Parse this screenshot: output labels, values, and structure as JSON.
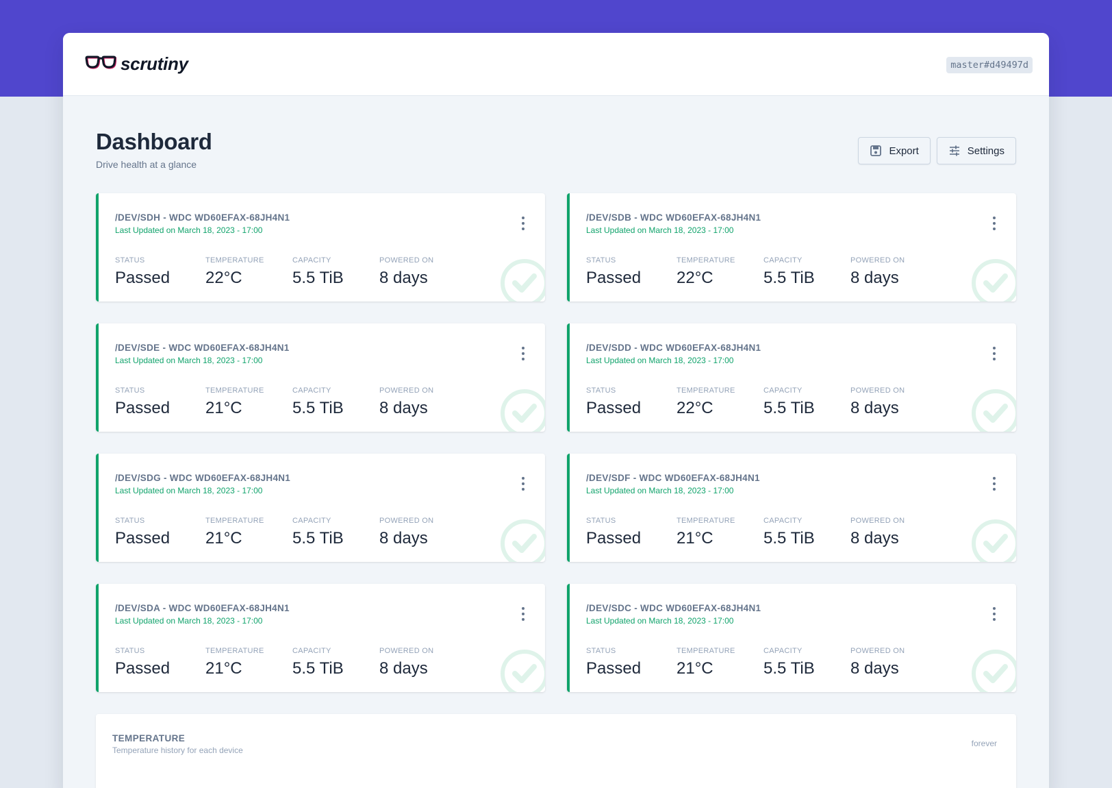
{
  "app": {
    "name": "scrutiny",
    "version": "master#d49497d"
  },
  "page": {
    "title": "Dashboard",
    "subtitle": "Drive health at a glance"
  },
  "actions": {
    "export_label": "Export",
    "settings_label": "Settings"
  },
  "colors": {
    "brand": "#5046cd",
    "passed": "#10a36b"
  },
  "stat_labels": {
    "status": "STATUS",
    "temperature": "TEMPERATURE",
    "capacity": "CAPACITY",
    "powered_on": "POWERED ON"
  },
  "devices": [
    {
      "title": "/DEV/SDH - WDC WD60EFAX-68JH4N1",
      "updated": "Last Updated on March 18, 2023 - 17:00",
      "status": "Passed",
      "temperature": "22°C",
      "capacity": "5.5 TiB",
      "powered_on": "8 days"
    },
    {
      "title": "/DEV/SDB - WDC WD60EFAX-68JH4N1",
      "updated": "Last Updated on March 18, 2023 - 17:00",
      "status": "Passed",
      "temperature": "22°C",
      "capacity": "5.5 TiB",
      "powered_on": "8 days"
    },
    {
      "title": "/DEV/SDE - WDC WD60EFAX-68JH4N1",
      "updated": "Last Updated on March 18, 2023 - 17:00",
      "status": "Passed",
      "temperature": "21°C",
      "capacity": "5.5 TiB",
      "powered_on": "8 days"
    },
    {
      "title": "/DEV/SDD - WDC WD60EFAX-68JH4N1",
      "updated": "Last Updated on March 18, 2023 - 17:00",
      "status": "Passed",
      "temperature": "22°C",
      "capacity": "5.5 TiB",
      "powered_on": "8 days"
    },
    {
      "title": "/DEV/SDG - WDC WD60EFAX-68JH4N1",
      "updated": "Last Updated on March 18, 2023 - 17:00",
      "status": "Passed",
      "temperature": "21°C",
      "capacity": "5.5 TiB",
      "powered_on": "8 days"
    },
    {
      "title": "/DEV/SDF - WDC WD60EFAX-68JH4N1",
      "updated": "Last Updated on March 18, 2023 - 17:00",
      "status": "Passed",
      "temperature": "21°C",
      "capacity": "5.5 TiB",
      "powered_on": "8 days"
    },
    {
      "title": "/DEV/SDA - WDC WD60EFAX-68JH4N1",
      "updated": "Last Updated on March 18, 2023 - 17:00",
      "status": "Passed",
      "temperature": "21°C",
      "capacity": "5.5 TiB",
      "powered_on": "8 days"
    },
    {
      "title": "/DEV/SDC - WDC WD60EFAX-68JH4N1",
      "updated": "Last Updated on March 18, 2023 - 17:00",
      "status": "Passed",
      "temperature": "21°C",
      "capacity": "5.5 TiB",
      "powered_on": "8 days"
    }
  ],
  "temperature_panel": {
    "title": "TEMPERATURE",
    "subtitle": "Temperature history for each device",
    "range": "forever"
  }
}
